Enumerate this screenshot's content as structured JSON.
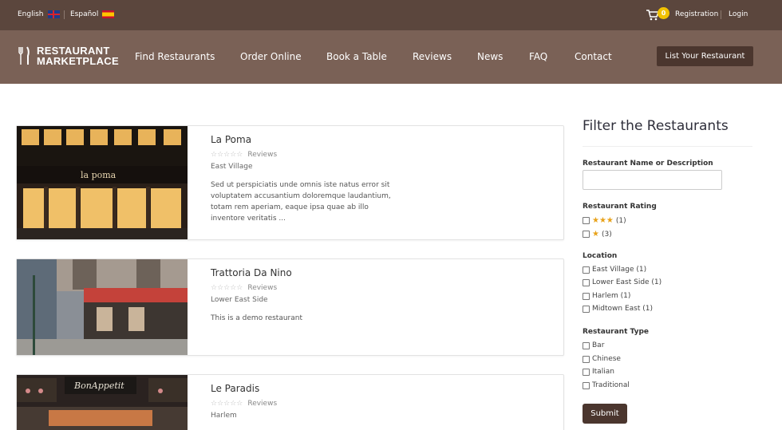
{
  "topbar": {
    "languages": [
      {
        "label": "English",
        "flag": "uk-flag-icon"
      },
      {
        "label": "Español",
        "flag": "spain-flag-icon"
      }
    ],
    "cart_count": "0",
    "registration_label": "Registration",
    "login_label": "Login"
  },
  "nav": {
    "logo_line1": "RESTAURANT",
    "logo_line2": "MARKETPLACE",
    "items": [
      "Find Restaurants",
      "Order Online",
      "Book a Table",
      "Reviews",
      "News",
      "FAQ",
      "Contact"
    ],
    "cta_label": "List Your Restaurant"
  },
  "listings": [
    {
      "name": "La Poma",
      "stars": "☆☆☆☆☆",
      "reviews_label": "Reviews",
      "area": "East Village",
      "description_lines": [
        "Sed ut perspiciatis unde omnis iste natus error sit",
        "voluptatem accusantium doloremque laudantium,",
        "totam rem aperiam, eaque ipsa quae ab illo",
        "inventore veritatis ..."
      ],
      "sign_text": "la poma"
    },
    {
      "name": "Trattoria Da Nino",
      "stars": "☆☆☆☆☆",
      "reviews_label": "Reviews",
      "area": "Lower East Side",
      "description_lines": [
        "This is a demo restaurant"
      ]
    },
    {
      "name": "Le Paradis",
      "stars": "☆☆☆☆☆",
      "reviews_label": "Reviews",
      "area": "Harlem",
      "description_lines": [],
      "sign_text": "BonAppetit"
    }
  ],
  "filter": {
    "title": "Filter the Restaurants",
    "name_label": "Restaurant Name or Description",
    "name_value": "",
    "rating_label": "Restaurant Rating",
    "ratings": [
      {
        "stars": "★★★",
        "count": "(1)"
      },
      {
        "stars": "★",
        "count": "(3)"
      }
    ],
    "location_label": "Location",
    "locations": [
      "East Village (1)",
      "Lower East Side (1)",
      "Harlem (1)",
      "Midtown East (1)"
    ],
    "type_label": "Restaurant Type",
    "types": [
      "Bar",
      "Chinese",
      "Italian",
      "Traditional"
    ],
    "submit_label": "Submit"
  },
  "colors": {
    "topbar_bg": "#5b463d",
    "nav_bg": "#7a6156",
    "button_bg": "#4b362e",
    "badge": "#f2c200",
    "star_active": "#e8a21a"
  }
}
